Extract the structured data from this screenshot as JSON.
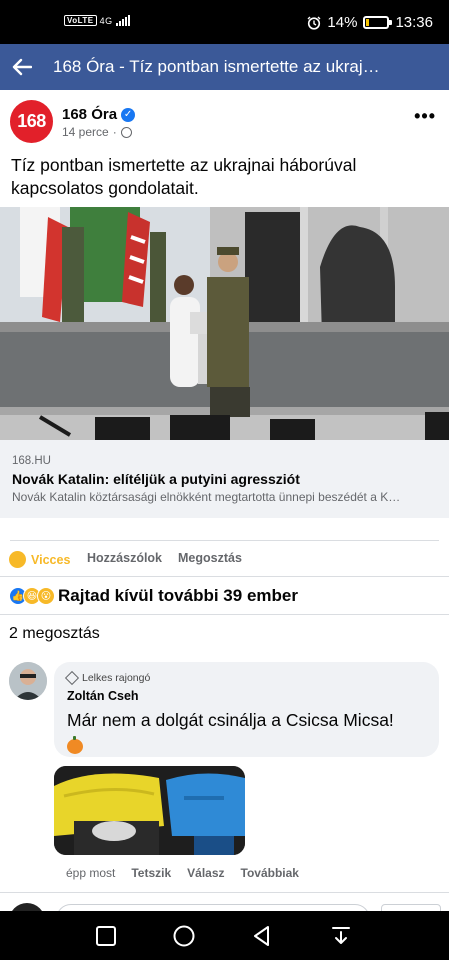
{
  "status_bar": {
    "network_left": "VoLTE",
    "network_type": "4G",
    "alarm_icon": "alarm-clock-icon",
    "battery_percent": "14%",
    "battery_level": 0.14,
    "time": "13:36"
  },
  "app_bar": {
    "back_icon": "arrow-left-icon",
    "title": "168 Óra - Tíz pontban ismertette az ukraj…"
  },
  "post": {
    "logo_text": "168",
    "page_name": "168 Óra",
    "verified_icon": "verified-check-icon",
    "time_ago": "14 perce",
    "separator": "·",
    "privacy_icon": "globe-icon",
    "more_icon": "more-dots-icon",
    "more_text": "•••",
    "text": "Tíz pontban ismertette az ukrajnai háborúval kapcsolatos gondolatait.",
    "link": {
      "domain": "168.HU",
      "title": "Novák Katalin: elítéljük a putyini agressziót",
      "description": "Novák Katalin köztársasági elnökként megtartotta ünnepi beszédét a K…"
    }
  },
  "actions": {
    "react_label": "Vicces",
    "react_emoji": "😆",
    "comment_label": "Hozzászólok",
    "share_label": "Megosztás"
  },
  "reactions": {
    "icons": [
      "like-icon",
      "haha-icon",
      "wow-icon"
    ],
    "like_glyph": "👍",
    "haha_glyph": "😆",
    "wow_glyph": "😮",
    "summary": "Rajtad kívül további 39 ember"
  },
  "shares": "2 megosztás",
  "comment": {
    "badge": "Lelkes rajongó",
    "author": "Zoltán Cseh",
    "text": "Már nem a dolgát csinálja a Csicsa Micsa!",
    "time": "épp most",
    "like_label": "Tetszik",
    "reply_label": "Válasz",
    "more_label": "Továbbiak"
  },
  "colors": {
    "facebook_blue": "#3b5998",
    "brand_red": "#e2202a",
    "verified_blue": "#1877f2",
    "haha_yellow": "#f7b928",
    "vicces_color": "#f7b928"
  }
}
